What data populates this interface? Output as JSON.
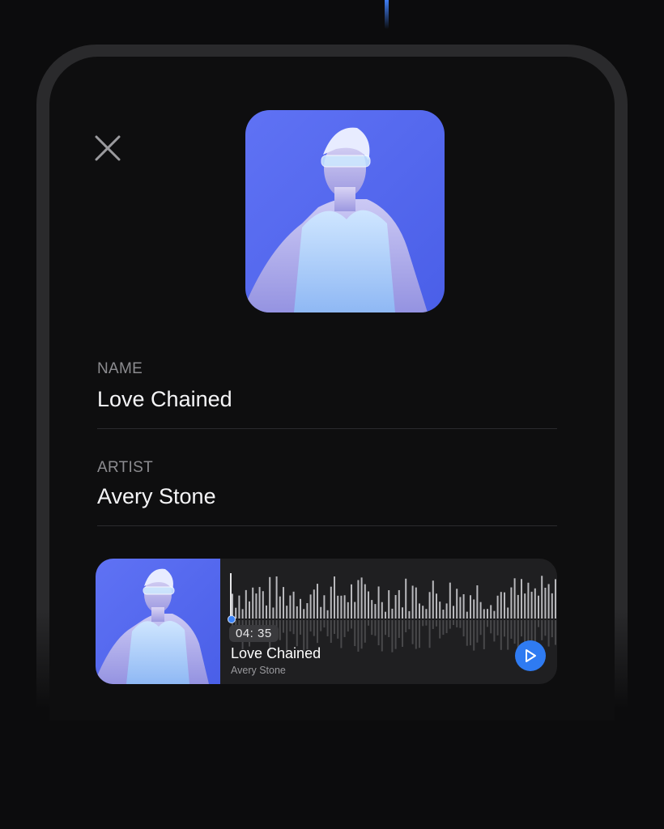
{
  "song": {
    "name_label": "NAME",
    "name": "Love Chained",
    "artist_label": "ARTIST",
    "artist": "Avery Stone"
  },
  "player": {
    "time": "04: 35",
    "title": "Love Chained",
    "artist": "Avery Stone",
    "progress": 0.0
  },
  "icons": {
    "close": "close-icon",
    "play": "play-icon"
  },
  "colors": {
    "accent": "#2f7bf2",
    "background": "#0c0c0d",
    "artwork_blue": "#5a6ff2"
  }
}
